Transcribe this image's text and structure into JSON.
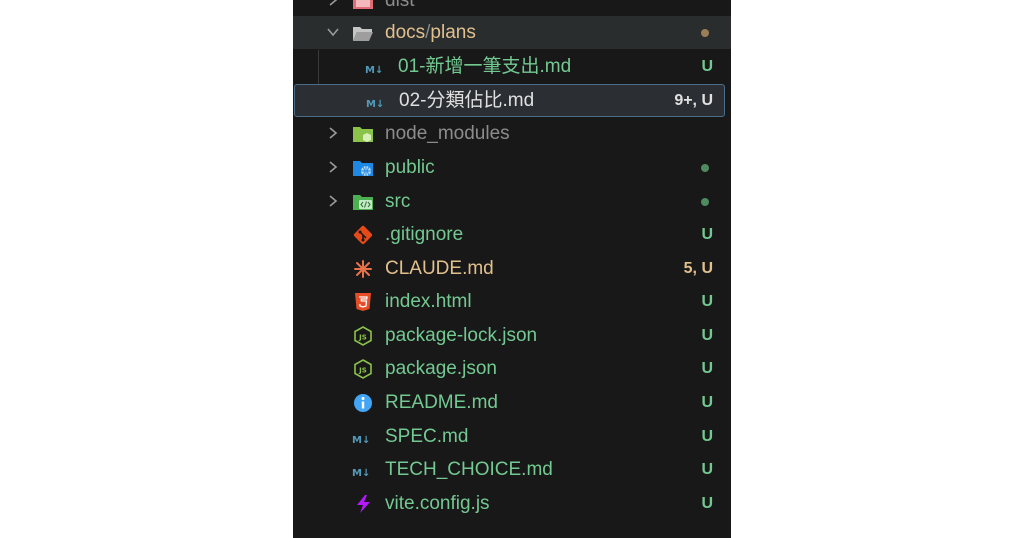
{
  "explorer": {
    "items": [
      {
        "name": "dist",
        "kind": "folder",
        "status": ""
      },
      {
        "name": "docs",
        "sep": "/",
        "name2": "plans",
        "kind": "folder-open",
        "status": "modified-dot"
      },
      {
        "name": "01-新增一筆支出.md",
        "kind": "markdown",
        "status": "U"
      },
      {
        "name": "02-分類佔比.md",
        "kind": "markdown",
        "status": "9+, U"
      },
      {
        "name": "node_modules",
        "kind": "folder",
        "status": ""
      },
      {
        "name": "public",
        "kind": "folder",
        "status": "untracked-dot"
      },
      {
        "name": "src",
        "kind": "folder",
        "status": "untracked-dot"
      },
      {
        "name": ".gitignore",
        "kind": "git",
        "status": "U"
      },
      {
        "name": "CLAUDE.md",
        "kind": "claude",
        "status": "5, U"
      },
      {
        "name": "index.html",
        "kind": "html",
        "status": "U"
      },
      {
        "name": "package-lock.json",
        "kind": "json-js",
        "status": "U"
      },
      {
        "name": "package.json",
        "kind": "json-js",
        "status": "U"
      },
      {
        "name": "README.md",
        "kind": "info",
        "status": "U"
      },
      {
        "name": "SPEC.md",
        "kind": "markdown",
        "status": "U"
      },
      {
        "name": "TECH_CHOICE.md",
        "kind": "markdown",
        "status": "U"
      },
      {
        "name": "vite.config.js",
        "kind": "vite",
        "status": "U"
      }
    ]
  },
  "colors": {
    "background": "#181818",
    "untracked_green": "#73c991",
    "modified_orange": "#e2c08d",
    "error_orange": "#e2c08d",
    "selected_border": "#4a6d8a"
  },
  "icons": {
    "chevron_right": "chevron-right-icon",
    "chevron_down": "chevron-down-icon",
    "markdown": "markdown-icon",
    "folder": "folder-icon"
  }
}
